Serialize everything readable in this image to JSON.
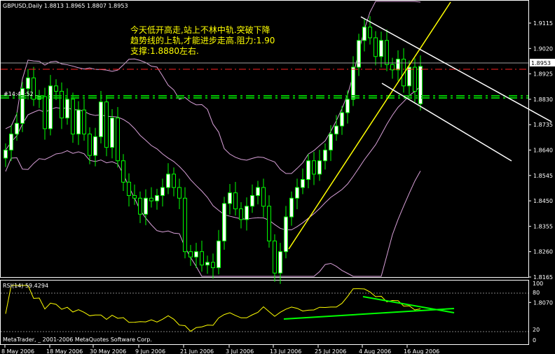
{
  "symbol_header": "GBPUSD,Daily  1.8813 1.8965 1.8807 1.8953",
  "annotation_lines": [
    "今天低开高走,站上不林中轨.突破下降",
    "趋势线的上轨,才能进步走高.阻力:1.90",
    "支撑:1.8880左右."
  ],
  "hline_label": "#14:44:52 ..",
  "current_price": "1.8953",
  "price_axis": {
    "ticks": [
      "1.9115",
      "1.9020",
      "1.8925",
      "1.8830",
      "1.8735",
      "1.8640",
      "1.8545",
      "1.8450",
      "1.8355",
      "1.8260",
      "1.8165",
      "1.8070"
    ]
  },
  "rsi": {
    "label": "RSI(14) 59.4294",
    "ticks": [
      "100",
      "80",
      "20",
      "0"
    ]
  },
  "copyright": "MetaTrader, _ 2001-2006 MetaQuotes Software Corp.",
  "date_axis": [
    "8 May 2006",
    "18 May 2006",
    "30 May 2006",
    "9 Jun 2006",
    "21 Jun 2006",
    "3 Jul 2006",
    "13 Jul 2006",
    "25 Jul 2006",
    "4 Aug 2006",
    "16 Aug 2006"
  ],
  "colors": {
    "background": "#000000",
    "candle": "#00ff00",
    "bull_body": "#ffffff",
    "bollinger": "#d8a0d8",
    "trendline_up": "#ffff00",
    "channel": "#ffffff",
    "resistance_line": "#ff0000",
    "support_line": "#00c000",
    "rsi_line": "#ffff00",
    "annotation_text": "#ffff00"
  },
  "chart_data": {
    "type": "candlestick",
    "title": "GBPUSD,Daily",
    "ohlc_last": {
      "open": 1.8813,
      "high": 1.8965,
      "low": 1.8807,
      "close": 1.8953
    },
    "ylim": [
      1.802,
      1.921
    ],
    "x": [
      "8 May",
      "9 May",
      "10 May",
      "11 May",
      "12 May",
      "15 May",
      "16 May",
      "17 May",
      "18 May",
      "19 May",
      "22 May",
      "23 May",
      "24 May",
      "25 May",
      "26 May",
      "29 May",
      "30 May",
      "31 May",
      "1 Jun",
      "2 Jun",
      "5 Jun",
      "6 Jun",
      "7 Jun",
      "8 Jun",
      "9 Jun",
      "12 Jun",
      "13 Jun",
      "14 Jun",
      "15 Jun",
      "16 Jun",
      "19 Jun",
      "20 Jun",
      "21 Jun",
      "22 Jun",
      "23 Jun",
      "26 Jun",
      "27 Jun",
      "28 Jun",
      "29 Jun",
      "30 Jun",
      "3 Jul",
      "4 Jul",
      "5 Jul",
      "6 Jul",
      "7 Jul",
      "10 Jul",
      "11 Jul",
      "12 Jul",
      "13 Jul",
      "14 Jul",
      "17 Jul",
      "18 Jul",
      "19 Jul",
      "20 Jul",
      "21 Jul",
      "24 Jul",
      "25 Jul",
      "26 Jul",
      "27 Jul",
      "28 Jul",
      "31 Jul",
      "1 Aug",
      "2 Aug",
      "3 Aug",
      "4 Aug",
      "7 Aug",
      "8 Aug",
      "9 Aug",
      "10 Aug",
      "11 Aug",
      "14 Aug",
      "15 Aug",
      "16 Aug",
      "17 Aug",
      "18 Aug"
    ],
    "close": [
      1.864,
      1.87,
      1.874,
      1.887,
      1.891,
      1.883,
      1.884,
      1.872,
      1.888,
      1.886,
      1.876,
      1.883,
      1.87,
      1.879,
      1.87,
      1.862,
      1.869,
      1.882,
      1.865,
      1.876,
      1.86,
      1.852,
      1.847,
      1.846,
      1.84,
      1.846,
      1.845,
      1.847,
      1.85,
      1.855,
      1.85,
      1.846,
      1.826,
      1.824,
      1.826,
      1.821,
      1.822,
      1.82,
      1.83,
      1.844,
      1.848,
      1.842,
      1.838,
      1.843,
      1.847,
      1.85,
      1.843,
      1.83,
      1.818,
      1.826,
      1.839,
      1.846,
      1.85,
      1.853,
      1.86,
      1.855,
      1.86,
      1.864,
      1.87,
      1.873,
      1.878,
      1.883,
      1.895,
      1.905,
      1.91,
      1.906,
      1.899,
      1.905,
      1.896,
      1.894,
      1.898,
      1.888,
      1.895,
      1.886,
      1.8953
    ]
  }
}
